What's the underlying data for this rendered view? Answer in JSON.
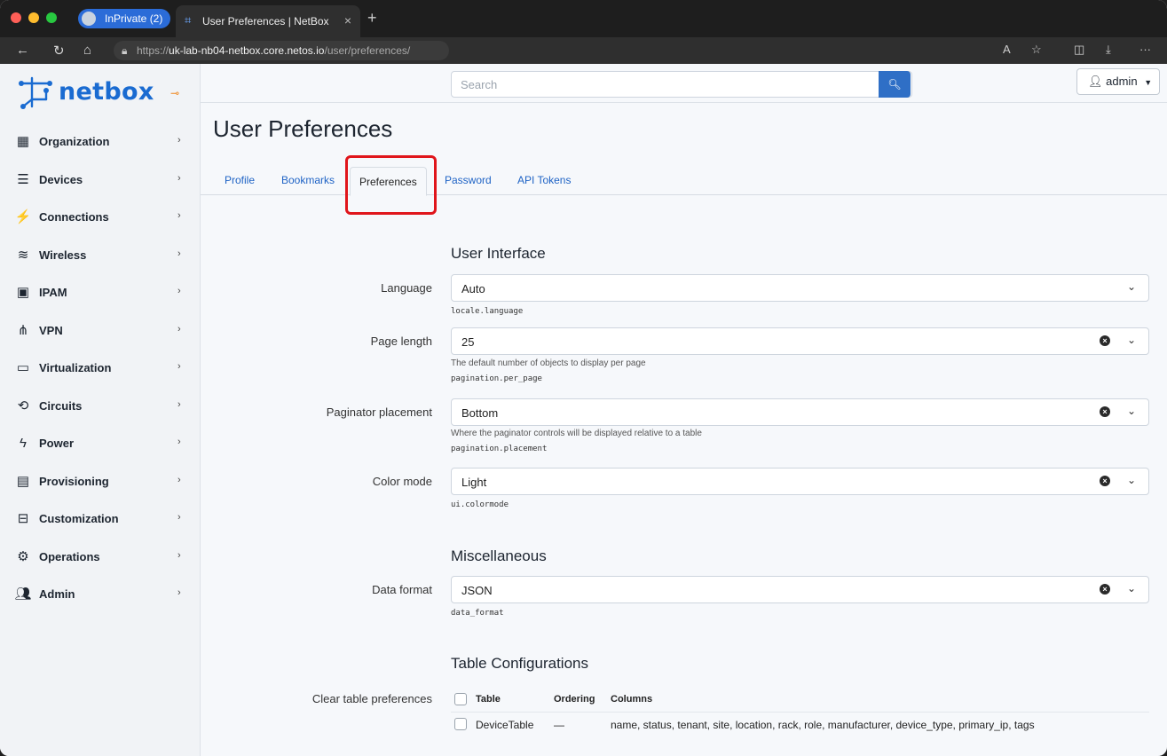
{
  "browser": {
    "inprivate_label": "InPrivate (2)",
    "tab_title": "User Preferences | NetBox",
    "url_prefix": "https://",
    "url_host": "uk-lab-nb04-netbox.core.netos.io",
    "url_path": "/user/preferences/"
  },
  "sidebar": {
    "logo_text": "netbox",
    "items": [
      {
        "label": "Organization",
        "icon": "building-icon"
      },
      {
        "label": "Devices",
        "icon": "server-icon"
      },
      {
        "label": "Connections",
        "icon": "plug-icon"
      },
      {
        "label": "Wireless",
        "icon": "wifi-icon"
      },
      {
        "label": "IPAM",
        "icon": "ip-icon"
      },
      {
        "label": "VPN",
        "icon": "vpn-icon"
      },
      {
        "label": "Virtualization",
        "icon": "monitor-icon"
      },
      {
        "label": "Circuits",
        "icon": "circuit-icon"
      },
      {
        "label": "Power",
        "icon": "power-icon"
      },
      {
        "label": "Provisioning",
        "icon": "document-icon"
      },
      {
        "label": "Customization",
        "icon": "toolbox-icon"
      },
      {
        "label": "Operations",
        "icon": "cogs-icon"
      },
      {
        "label": "Admin",
        "icon": "users-icon"
      }
    ]
  },
  "header": {
    "search_placeholder": "Search",
    "user_label": "admin"
  },
  "page": {
    "title": "User Preferences",
    "tabs": [
      "Profile",
      "Bookmarks",
      "Preferences",
      "Password",
      "API Tokens"
    ],
    "active_tab": "Preferences"
  },
  "form": {
    "ui_section": "User Interface",
    "language": {
      "label": "Language",
      "value": "Auto",
      "key": "locale.language"
    },
    "page_length": {
      "label": "Page length",
      "value": "25",
      "help": "The default number of objects to display per page",
      "key": "pagination.per_page"
    },
    "paginator": {
      "label": "Paginator placement",
      "value": "Bottom",
      "help": "Where the paginator controls will be displayed relative to a table",
      "key": "pagination.placement"
    },
    "color_mode": {
      "label": "Color mode",
      "value": "Light",
      "key": "ui.colormode"
    },
    "misc_section": "Miscellaneous",
    "data_format": {
      "label": "Data format",
      "value": "JSON",
      "key": "data_format"
    },
    "table_section": "Table Configurations",
    "clear_label": "Clear table preferences",
    "table_headers": [
      "Table",
      "Ordering",
      "Columns"
    ],
    "table_rows": [
      {
        "table": "DeviceTable",
        "ordering": "—",
        "columns": "name, status, tenant, site, location, rack, role, manufacturer, device_type, primary_ip, tags"
      }
    ]
  },
  "colors": {
    "accent": "#1f63c5",
    "highlight": "#e0151b"
  }
}
